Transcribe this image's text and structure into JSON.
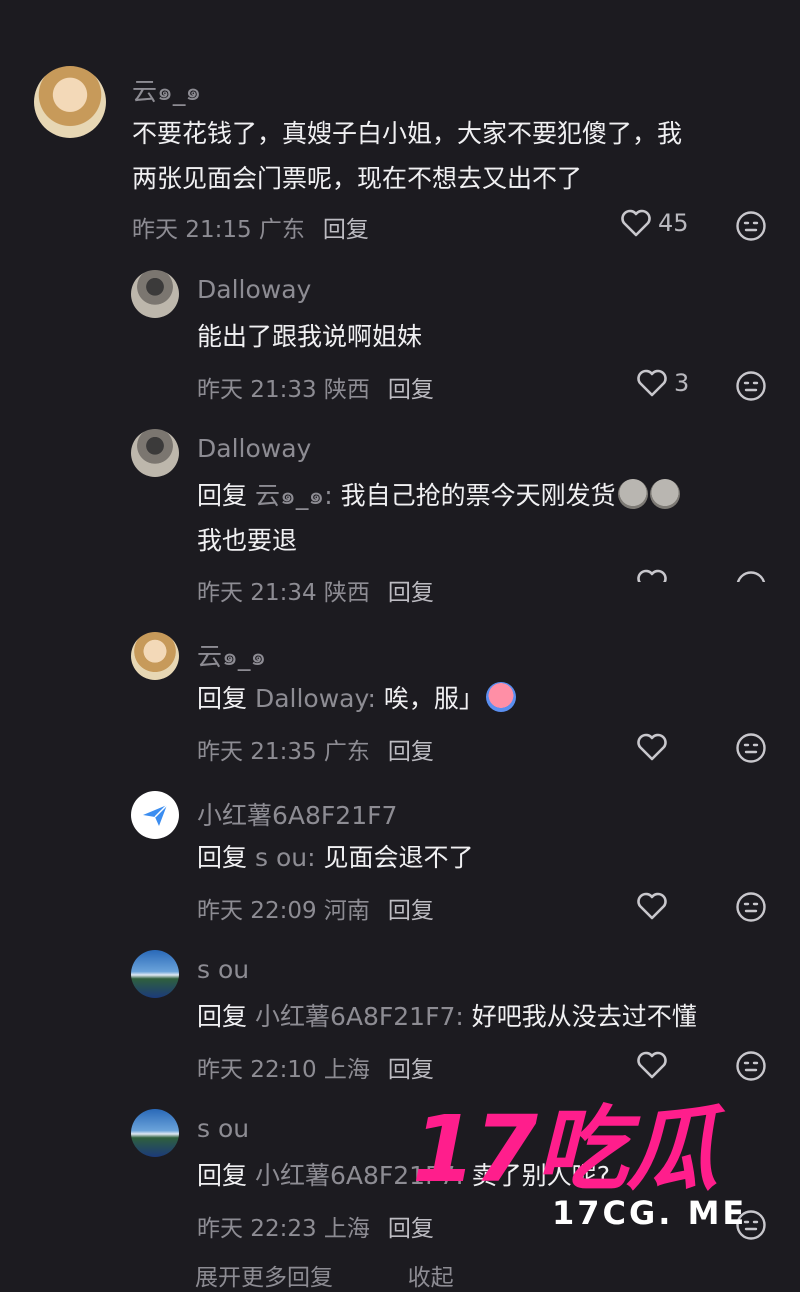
{
  "comments": [
    {
      "author": "云๑_๑",
      "reply_prefix": "",
      "reply_to": "",
      "text_lines": [
        "不要花钱了，真嫂子白小姐，大家不要犯傻了，我",
        "两张见面会门票呢，现在不想去又出不了"
      ],
      "time": "昨天 21:15 广东",
      "reply_label": "回复",
      "likes": "45"
    },
    {
      "author": "Dalloway",
      "reply_prefix": "",
      "reply_to": "",
      "text_lines": [
        "能出了跟我说啊姐妹"
      ],
      "time": "昨天 21:33 陕西",
      "reply_label": "回复",
      "likes": "3"
    },
    {
      "author": "Dalloway",
      "reply_prefix": "回复",
      "reply_to": "云๑_๑:",
      "text_lines": [
        "我自己抢的票今天刚发货",
        "我也要退"
      ],
      "time": "昨天 21:34 陕西",
      "reply_label": "回复",
      "likes": ""
    },
    {
      "author": "云๑_๑",
      "reply_prefix": "回复",
      "reply_to": "Dalloway:",
      "text_lines": [
        "唉，服」"
      ],
      "time": "昨天 21:35 广东",
      "reply_label": "回复",
      "likes": ""
    },
    {
      "author": "小红薯6A8F21F7",
      "reply_prefix": "回复",
      "reply_to": "s ou:",
      "text_lines": [
        "见面会退不了"
      ],
      "time": "昨天 22:09 河南",
      "reply_label": "回复",
      "likes": ""
    },
    {
      "author": "s ou",
      "reply_prefix": "回复",
      "reply_to": "小红薯6A8F21F7:",
      "text_lines": [
        "好吧我从没去过不懂"
      ],
      "time": "昨天 22:10 上海",
      "reply_label": "回复",
      "likes": ""
    },
    {
      "author": "s ou",
      "reply_prefix": "回复",
      "reply_to": "小红薯6A8F21F7:",
      "text_lines": [
        "卖了别人呢?"
      ],
      "time": "昨天 22:23 上海",
      "reply_label": "回复",
      "likes": ""
    }
  ],
  "footer": {
    "more_replies": "展开更多回复",
    "collapse": "收起"
  },
  "watermark": {
    "line1": "17吃瓜",
    "line2": "17CG. ME"
  },
  "icons": {
    "like": "heart-icon",
    "emoji": "emoji-face-icon",
    "avatar_plane": "paper-plane-icon"
  },
  "colors": {
    "background": "#1c1b20",
    "watermark": "#ff1e8c",
    "text": "#f0f0f2",
    "muted": "#8d8c93"
  }
}
